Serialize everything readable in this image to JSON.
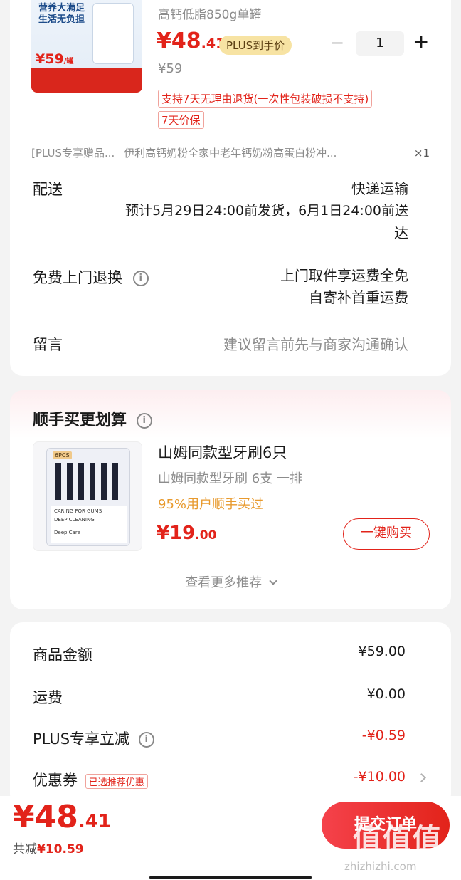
{
  "product": {
    "subtitle": "高钙低脂850g单罐",
    "price_int": "¥48",
    "price_dec": ".41",
    "plus_badge": "PLUS到手价",
    "original_price": "¥59",
    "quantity": "1",
    "minus": "−",
    "plus": "+",
    "tag_return": "支持7天无理由退货(一次性包装破损不支持)",
    "tag_price": "7天价保",
    "thumb_text1": "营养大满足",
    "thumb_text2": "生活无负担",
    "thumb_price": "¥59",
    "thumb_price_unit": "/罐"
  },
  "gift": {
    "label": "[PLUS专享赠品...",
    "name": "伊利高钙奶粉全家中老年钙奶粉高蛋白粉冲...",
    "qty": "×1"
  },
  "delivery": {
    "label": "配送",
    "method": "快递运输",
    "eta_line1": "预计5月29日24:00前发货，6月1日24:00前送",
    "eta_line2": "达"
  },
  "return_service": {
    "label": "免费上门退换",
    "line1": "上门取件享运费全免",
    "line2": "自寄补首重运费"
  },
  "message": {
    "label": "留言",
    "placeholder": "建议留言前先与商家沟通确认"
  },
  "recommend": {
    "title": "顺手买更划算",
    "item_title": "山姆同款型牙刷6只",
    "item_sub": "山姆同款型牙刷 6支 一排",
    "item_note": "95%用户顺手买过",
    "item_price_int": "¥19",
    "item_price_dec": ".00",
    "buy_button": "一键购买",
    "more": "查看更多推荐",
    "thumb_badge": "6PCS",
    "thumb_line1": "CARING FOR GUMS",
    "thumb_line2": "DEEP CLEANING",
    "thumb_line3": "Deep Care"
  },
  "summary": {
    "rows": [
      {
        "label": "商品金额",
        "value": "¥59.00"
      },
      {
        "label": "运费",
        "value": "¥0.00"
      },
      {
        "label": "PLUS专享立减",
        "value": "-¥0.59"
      },
      {
        "label": "优惠券",
        "value": "-¥10.00",
        "badge": "已选推荐优惠"
      }
    ]
  },
  "footer": {
    "total_int": "¥48",
    "total_dec": ".41",
    "saved_label": "共减",
    "saved_value": "¥10.59",
    "submit": "提交订单",
    "watermark": "值 值 值",
    "watermark_url": "zhizhizhi.com"
  },
  "colors": {
    "accent": "#e2231a",
    "plus_badge_bg": "#f7e3a3",
    "orange_note": "#e89a2e"
  }
}
